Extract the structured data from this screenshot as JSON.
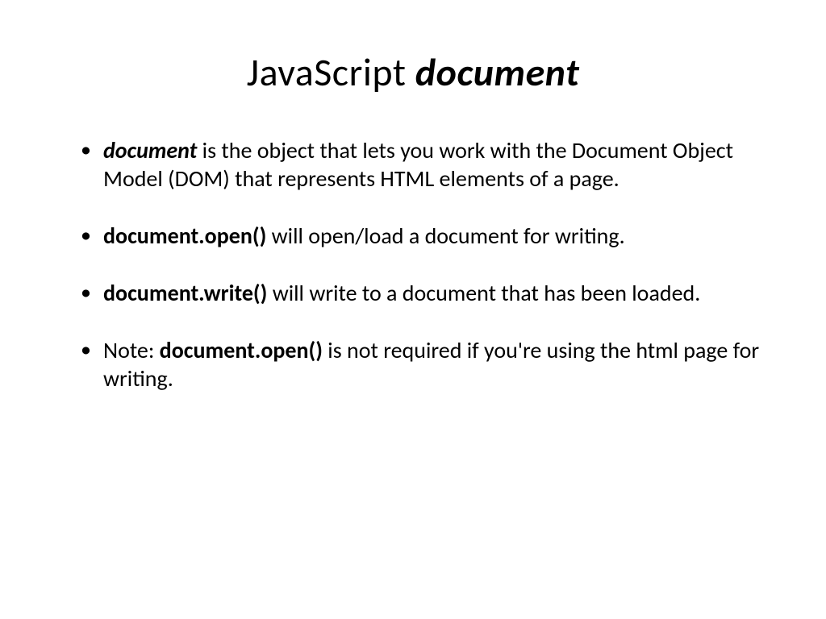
{
  "title": {
    "part1": "JavaScript ",
    "part2": "document"
  },
  "bullets": [
    {
      "lead_bold_italic": "document",
      "rest": " is the object that lets you work with the Document Object Model (DOM) that represents HTML elements of a page."
    },
    {
      "lead_bold": "document.open()",
      "rest": " will open/load a document for writing."
    },
    {
      "lead_bold": "document.write()",
      "rest": " will write to a document that has been loaded."
    },
    {
      "pre": "Note: ",
      "lead_bold": "document.open()",
      "rest": " is not required if you're using the html page for writing."
    }
  ]
}
